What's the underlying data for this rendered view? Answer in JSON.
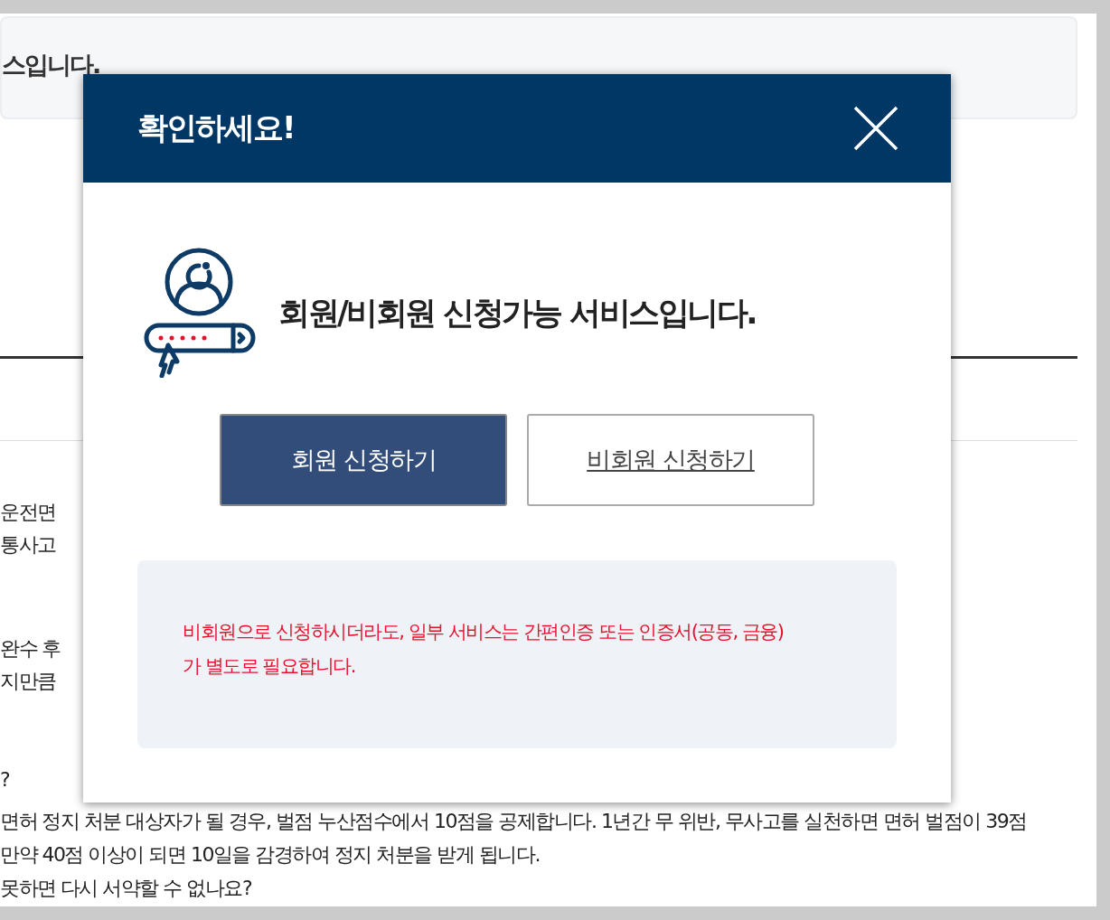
{
  "page": {
    "banner_text": "스입니다.",
    "lines_upper": [
      "운전면",
      "통사고"
    ],
    "lines_middle": [
      "완수 후",
      "지만큼"
    ],
    "lines_lower": [
      "?",
      "면허 정지 처분 대상자가 될 경우, 벌점 누산점수에서 10점을 공제합니다. 1년간 무 위반, 무사고를 실천하면 면허 벌점이 39점",
      "만약 40점 이상이 되면 10일을 감경하여 정지 처분을 받게 됩니다.",
      "못하면 다시 서약할 수 없나요?"
    ]
  },
  "dialog": {
    "title": "확인하세요!",
    "message": "회원/비회원 신청가능 서비스입니다.",
    "buttons": [
      {
        "label": "회원 신청하기",
        "kind": "primary"
      },
      {
        "label": "비회원 신청하기",
        "kind": "secondary"
      }
    ],
    "notice": "비회원으로 신청하시더라도, 일부 서비스는 간편인증 또는 인증서(공동, 금융) 가 별도로 필요합니다."
  }
}
